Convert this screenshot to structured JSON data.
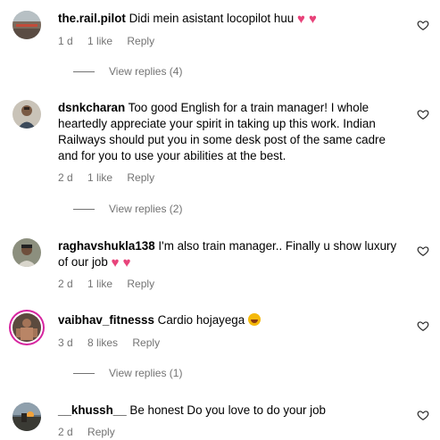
{
  "comments": [
    {
      "username": "the.rail.pilot",
      "text": "Didi mein asistant locopilot huu",
      "emoji": "♥ ♥",
      "time": "1 d",
      "likes": "1 like",
      "reply_label": "Reply",
      "view_replies": "View replies (4)"
    },
    {
      "username": "dsnkcharan",
      "text": "Too good English for a train manager! I whole heartedly appreciate your spirit in taking up this work. Indian Railways should put you in some desk post of the same cadre and for you to use your abilities at the best.",
      "time": "2 d",
      "likes": "1 like",
      "reply_label": "Reply",
      "view_replies": "View replies (2)"
    },
    {
      "username": "raghavshukla138",
      "text": "I'm also train manager.. Finally u show luxury of our job",
      "emoji": "♥ ♥",
      "time": "2 d",
      "likes": "1 like",
      "reply_label": "Reply"
    },
    {
      "username": "vaibhav_fitnesss",
      "text": "Cardio hojayega",
      "time": "3 d",
      "likes": "8 likes",
      "reply_label": "Reply",
      "view_replies": "View replies (1)"
    },
    {
      "username": "__khussh__",
      "text": "Be honest Do you love to do your job",
      "time": "2 d",
      "reply_label": "Reply"
    }
  ],
  "icons": {
    "like": "heart-outline-icon",
    "reaction_heart": "pink-heart-emoji",
    "reaction_laugh": "laughing-emoji"
  },
  "colors": {
    "meta_text": "#737373",
    "emoji_heart": "#e8437a",
    "story_ring": "#d6249f"
  }
}
